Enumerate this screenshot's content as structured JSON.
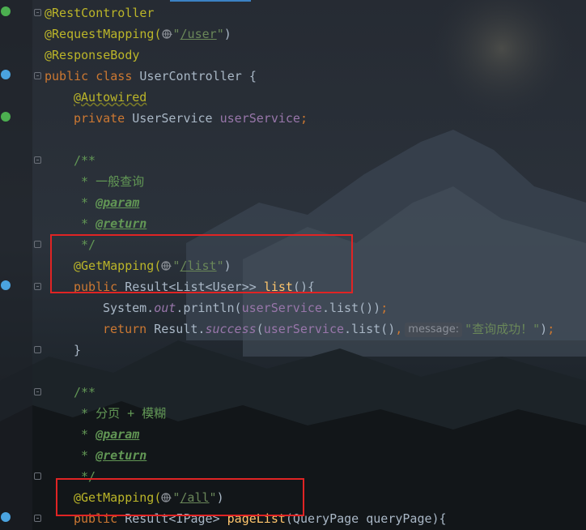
{
  "editor": {
    "lines": [
      {
        "id": "l1",
        "text_parts": [
          {
            "cls": "ann",
            "t": "@RestController"
          }
        ]
      },
      {
        "id": "l2",
        "text_parts": [
          {
            "cls": "ann",
            "t": "@RequestMapping("
          },
          {
            "cls": "str",
            "t": "\""
          },
          {
            "cls": "strlink",
            "t": "/user"
          },
          {
            "cls": "str",
            "t": "\""
          },
          {
            "cls": "plain",
            "t": ")"
          }
        ]
      },
      {
        "id": "l3",
        "text_parts": [
          {
            "cls": "ann",
            "t": "@ResponseBody"
          }
        ]
      },
      {
        "id": "l4",
        "text_parts": [
          {
            "cls": "kw",
            "t": "public class "
          },
          {
            "cls": "cls",
            "t": "UserController {"
          }
        ]
      },
      {
        "id": "l5",
        "text_parts": [
          {
            "cls": "ann",
            "t": "@Autowired"
          }
        ]
      },
      {
        "id": "l6",
        "text_parts": [
          {
            "cls": "kw",
            "t": "private "
          },
          {
            "cls": "cls",
            "t": "UserService "
          },
          {
            "cls": "fld",
            "t": "userService"
          },
          {
            "cls": "kw",
            "t": ";"
          }
        ]
      },
      {
        "id": "l7",
        "text_parts": []
      },
      {
        "id": "l8",
        "text_parts": [
          {
            "cls": "doc",
            "t": "/**"
          }
        ]
      },
      {
        "id": "l9",
        "text_parts": [
          {
            "cls": "doc",
            "t": " * 一般查询"
          }
        ]
      },
      {
        "id": "l10",
        "text_parts": [
          {
            "cls": "doc",
            "t": " * "
          },
          {
            "cls": "doctag",
            "t": "@param"
          }
        ]
      },
      {
        "id": "l11",
        "text_parts": [
          {
            "cls": "doc",
            "t": " * "
          },
          {
            "cls": "doctag",
            "t": "@return"
          }
        ]
      },
      {
        "id": "l12",
        "text_parts": [
          {
            "cls": "doc",
            "t": " */"
          }
        ]
      },
      {
        "id": "l13",
        "text_parts": [
          {
            "cls": "ann",
            "t": "@GetMapping("
          },
          {
            "cls": "str",
            "t": "\""
          },
          {
            "cls": "strlink",
            "t": "/list"
          },
          {
            "cls": "str",
            "t": "\""
          },
          {
            "cls": "plain",
            "t": ")"
          }
        ]
      },
      {
        "id": "l14",
        "text_parts": [
          {
            "cls": "kw",
            "t": "public "
          },
          {
            "cls": "cls",
            "t": "Result<List<User>> "
          },
          {
            "cls": "meth",
            "t": "list"
          },
          {
            "cls": "plain",
            "t": "(){"
          }
        ]
      },
      {
        "id": "l15",
        "text_parts": [
          {
            "cls": "cls",
            "t": "System."
          },
          {
            "cls": "st",
            "t": "out"
          },
          {
            "cls": "plain",
            "t": ".println("
          },
          {
            "cls": "fld",
            "t": "userService"
          },
          {
            "cls": "plain",
            "t": ".list())"
          },
          {
            "cls": "kw",
            "t": ";"
          }
        ]
      },
      {
        "id": "l16",
        "text_parts": [
          {
            "cls": "kw",
            "t": "return "
          },
          {
            "cls": "cls",
            "t": "Result."
          },
          {
            "cls": "st",
            "t": "success"
          },
          {
            "cls": "plain",
            "t": "("
          },
          {
            "cls": "fld",
            "t": "userService"
          },
          {
            "cls": "plain",
            "t": ".list()"
          },
          {
            "cls": "kw",
            "t": ","
          },
          {
            "cls": "hint",
            "t": "message:"
          },
          {
            "cls": "str",
            "t": "\"查询成功！\""
          },
          {
            "cls": "plain",
            "t": ")"
          },
          {
            "cls": "kw",
            "t": ";"
          }
        ]
      },
      {
        "id": "l17",
        "text_parts": [
          {
            "cls": "plain",
            "t": "}"
          }
        ]
      },
      {
        "id": "l18",
        "text_parts": []
      },
      {
        "id": "l19",
        "text_parts": [
          {
            "cls": "doc",
            "t": "/**"
          }
        ]
      },
      {
        "id": "l20",
        "text_parts": [
          {
            "cls": "doc",
            "t": " * 分页 + 模糊"
          }
        ]
      },
      {
        "id": "l21",
        "text_parts": [
          {
            "cls": "doc",
            "t": " * "
          },
          {
            "cls": "doctag",
            "t": "@param"
          }
        ]
      },
      {
        "id": "l22",
        "text_parts": [
          {
            "cls": "doc",
            "t": " * "
          },
          {
            "cls": "doctag",
            "t": "@return"
          }
        ]
      },
      {
        "id": "l23",
        "text_parts": [
          {
            "cls": "doc",
            "t": " */"
          }
        ]
      },
      {
        "id": "l24",
        "text_parts": [
          {
            "cls": "ann",
            "t": "@GetMapping("
          },
          {
            "cls": "str",
            "t": "\""
          },
          {
            "cls": "strlink",
            "t": "/all"
          },
          {
            "cls": "str",
            "t": "\""
          },
          {
            "cls": "plain",
            "t": ")"
          }
        ]
      },
      {
        "id": "l25",
        "text_parts": [
          {
            "cls": "kw",
            "t": "public "
          },
          {
            "cls": "cls",
            "t": "Result<IPage> "
          },
          {
            "cls": "meth",
            "t": "pageList"
          },
          {
            "cls": "plain",
            "t": "(QueryPage queryPage){"
          }
        ]
      }
    ]
  },
  "colors": {
    "annotation": "#bbb529",
    "keyword": "#cc7832",
    "string": "#6a8759",
    "doc": "#629755",
    "method": "#ffc66d",
    "field": "#9876aa",
    "highlight_box": "#e02424"
  }
}
